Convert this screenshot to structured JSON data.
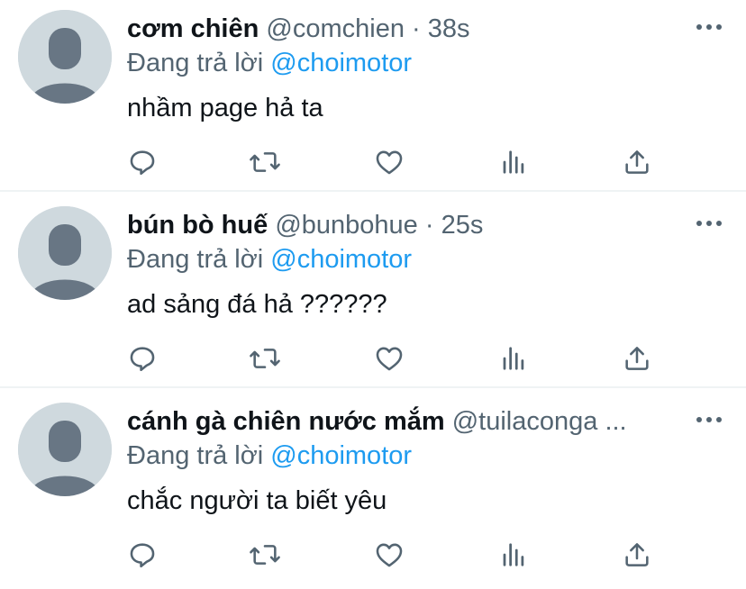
{
  "colors": {
    "text_primary": "#0f1419",
    "text_secondary": "#536471",
    "accent": "#1d9bf0",
    "avatar_bg": "#cfd9de",
    "avatar_fg": "#687684",
    "divider": "#eff3f4"
  },
  "icons": [
    "default-avatar-icon",
    "more-options-icon",
    "reply-icon",
    "retweet-icon",
    "like-icon",
    "analytics-icon",
    "share-icon"
  ],
  "replies": [
    {
      "display_name": "cơm chiên",
      "handle": "@comchien",
      "separator": "·",
      "time": "38s",
      "replying_prefix": "Đang trả lời",
      "replying_to": "@choimotor",
      "text": "nhầm page hả ta"
    },
    {
      "display_name": "bún bò huế",
      "handle": "@bunbohue",
      "separator": "·",
      "time": "25s",
      "replying_prefix": "Đang trả lời",
      "replying_to": "@choimotor",
      "text": "ad sảng đá hả ??????"
    },
    {
      "display_name": "cánh gà chiên nước mắm",
      "handle": "@tuilaconga ...",
      "separator": "",
      "time": "",
      "replying_prefix": "Đang trả lời",
      "replying_to": "@choimotor",
      "text": "chắc người ta biết yêu"
    }
  ]
}
